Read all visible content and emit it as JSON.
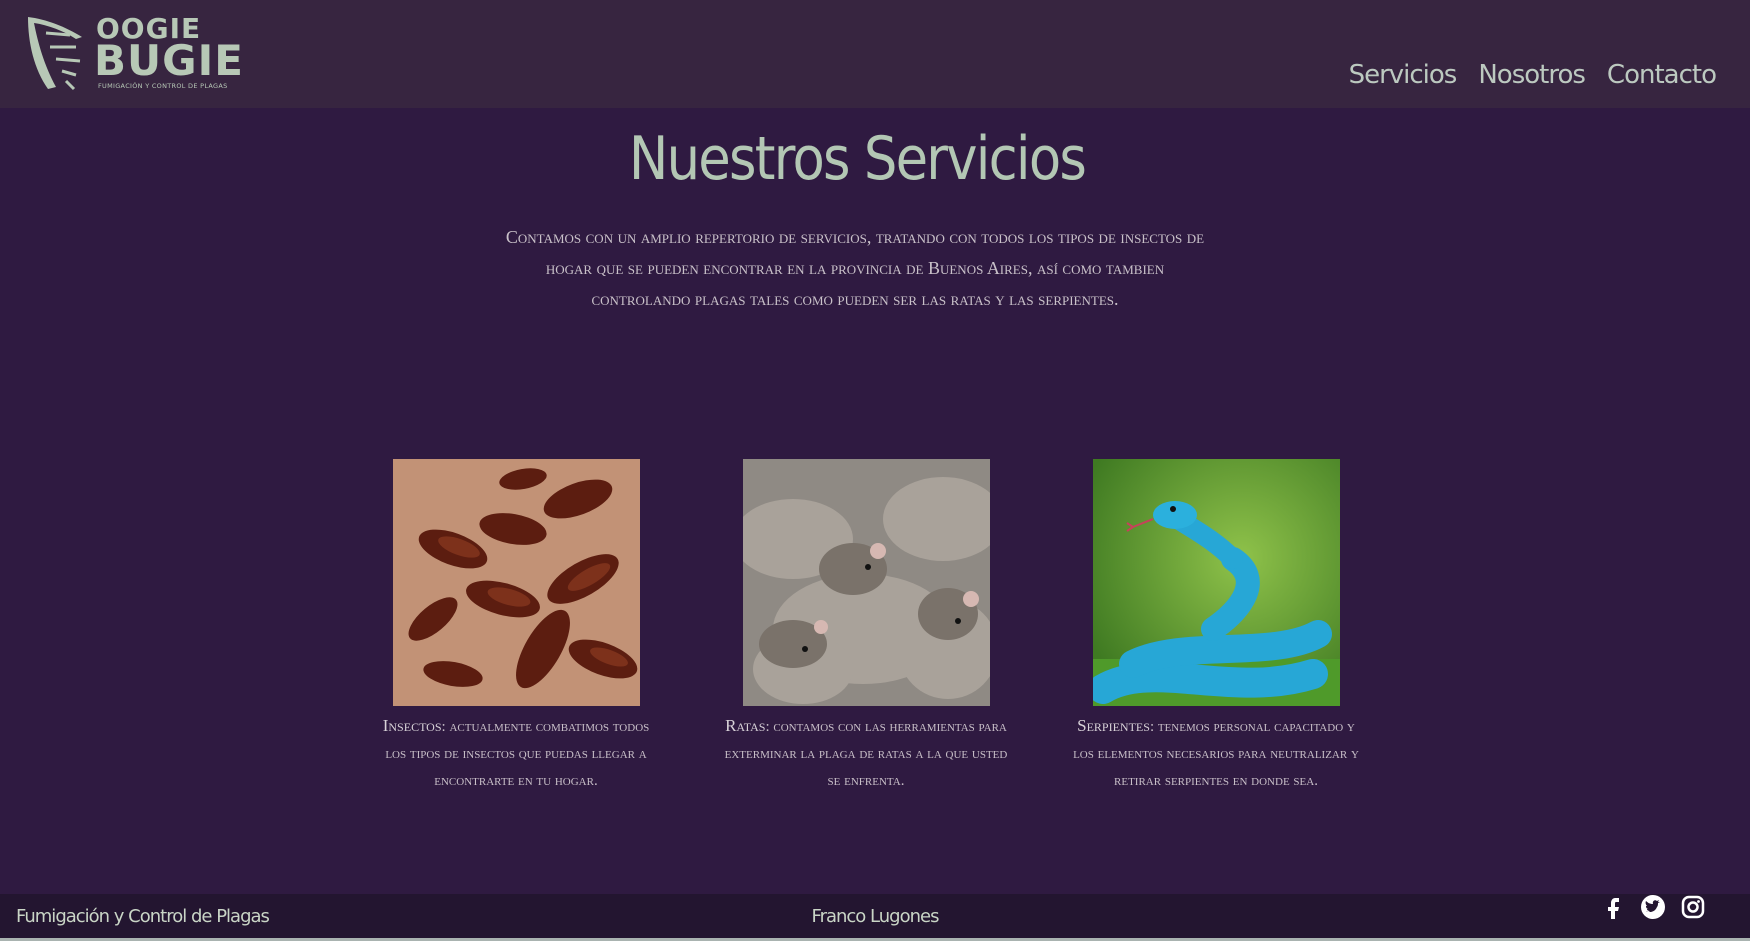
{
  "header": {
    "logo": {
      "word1": "OOGIE",
      "word2": "BUGIE",
      "tagline": "Fumigación y control de plagas"
    },
    "nav": [
      {
        "label": "Servicios"
      },
      {
        "label": "Nosotros"
      },
      {
        "label": "Contacto"
      }
    ]
  },
  "main": {
    "title": "Nuestros Servicios",
    "intro": "Contamos con un amplio repertorio de servicios, tratando con todos los tipos de insectos de hogar que se pueden encontrar en la provincia de Buenos Aires, así como tambien controlando plagas tales como pueden ser las ratas y las serpientes.",
    "services": [
      {
        "name": "Insectos",
        "text": ": actualmente combatimos todos los tipos de insectos que puedas llegar a encontrarte en tu hogar."
      },
      {
        "name": "Ratas",
        "text": ": contamos con las herramientas para exterminar la plaga de ratas a la que usted se enfrenta."
      },
      {
        "name": "Serpientes",
        "text": ": tenemos personal capacitado y los elementos necesarios para neutralizar y retirar serpientes en donde sea."
      }
    ]
  },
  "footer": {
    "left": "Fumigación y Control de Plagas",
    "center": "Franco Lugones",
    "socials": [
      "facebook-icon",
      "twitter-icon",
      "instagram-icon"
    ]
  },
  "colors": {
    "background": "#2f1a41",
    "header_bg": "#372540",
    "footer_bg": "#231530",
    "accent": "#b3c7b4"
  }
}
